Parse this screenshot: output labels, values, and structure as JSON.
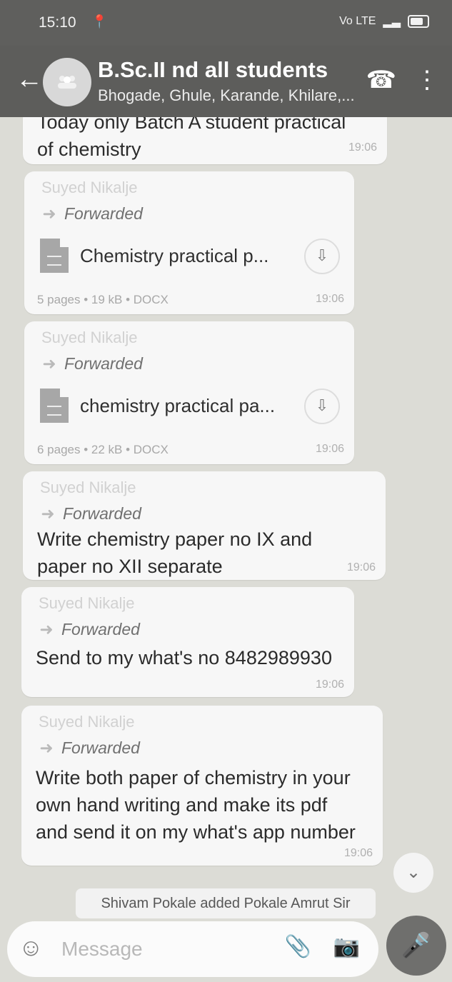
{
  "status_bar": {
    "time": "15:10",
    "location_icon": "location-pin",
    "network": "Vo LTE",
    "battery_icon": "battery"
  },
  "app_bar": {
    "back_icon": "arrow-left",
    "title": "B.Sc.II nd all students",
    "subtitle": "Bhogade, Ghule, Karande, Khilare,...",
    "call_icon": "add-call",
    "menu_icon": "more-vertical"
  },
  "messages": [
    {
      "type": "text",
      "text": "Today only Batch A student practical\nof chemistry",
      "time": "19:06"
    },
    {
      "type": "document",
      "sender": "Suyed Nikalje",
      "forwarded_label": "Forwarded",
      "file_name": "Chemistry practical p...",
      "meta": "5 pages • 19 kB • DOCX",
      "time": "19:06"
    },
    {
      "type": "document",
      "sender": "Suyed Nikalje",
      "forwarded_label": "Forwarded",
      "file_name": "chemistry practical pa...",
      "meta": "6 pages • 22 kB • DOCX",
      "time": "19:06"
    },
    {
      "type": "text",
      "sender": "Suyed Nikalje",
      "forwarded_label": "Forwarded",
      "text": "Write chemistry paper no IX and\npaper no XII separate",
      "time": "19:06"
    },
    {
      "type": "text",
      "sender": "Suyed Nikalje",
      "forwarded_label": "Forwarded",
      "text": "Send to my what's no 8482989930",
      "time": "19:06"
    },
    {
      "type": "text",
      "sender": "Suyed Nikalje",
      "forwarded_label": "Forwarded",
      "text": "Write both paper of chemistry in your\nown hand writing and make its pdf\nand send it on my what's app number",
      "time": "19:06"
    }
  ],
  "system_note": "Shivam Pokale added Pokale Amrut Sir",
  "composer": {
    "emoji_icon": "emoji",
    "placeholder": "Message",
    "attach_icon": "paperclip",
    "camera_icon": "camera",
    "mic_icon": "microphone"
  },
  "scroll_icon": "double-chevron-down",
  "colors": {
    "header": "#5d5d5b",
    "chat_background": "#dcdcd6",
    "bubble": "#f7f7f7",
    "mic_button": "#6f6f6d"
  }
}
